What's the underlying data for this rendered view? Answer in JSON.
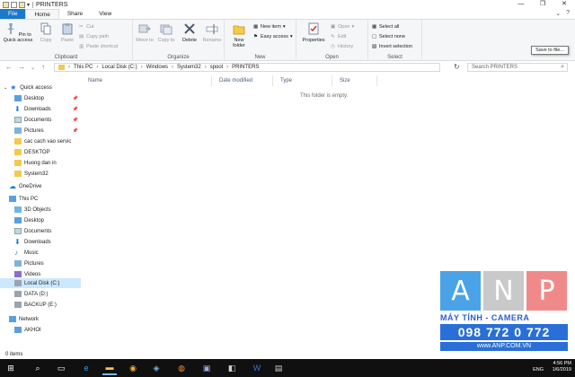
{
  "window": {
    "title": "PRINTERS"
  },
  "ribbon_tabs": [
    "File",
    "Home",
    "Share",
    "View"
  ],
  "ribbon": {
    "clipboard": {
      "label": "Clipboard",
      "pin": "Pin to Quick access",
      "copy": "Copy",
      "paste": "Paste",
      "cut": "Cut",
      "copy_path": "Copy path",
      "paste_shortcut": "Paste shortcut"
    },
    "organize": {
      "label": "Organize",
      "move_to": "Move to",
      "copy_to": "Copy to",
      "delete": "Delete",
      "rename": "Rename"
    },
    "new": {
      "label": "New",
      "new_folder": "New folder",
      "new_item": "New item",
      "easy_access": "Easy access"
    },
    "open": {
      "label": "Open",
      "properties": "Properties",
      "open": "Open",
      "edit": "Edit",
      "history": "History"
    },
    "select": {
      "label": "Select",
      "select_all": "Select all",
      "select_none": "Select none",
      "invert": "Invert selection"
    }
  },
  "tooltip": "Save to file...",
  "breadcrumb": [
    "This PC",
    "Local Disk (C:)",
    "Windows",
    "System32",
    "spool",
    "PRINTERS"
  ],
  "search": {
    "placeholder": "Search PRINTERS"
  },
  "nav": {
    "quick_access": "Quick access",
    "quick_items": [
      "Desktop",
      "Downloads",
      "Documents",
      "Pictures",
      "cac cach vao servic",
      "DESKTOP",
      "Huong dan in",
      "System32"
    ],
    "onedrive": "OneDrive",
    "this_pc": "This PC",
    "pc_items": [
      "3D Objects",
      "Desktop",
      "Documents",
      "Downloads",
      "Music",
      "Pictures",
      "Videos",
      "Local Disk (C:)",
      "DATA (D:)",
      "BACKUP (E:)"
    ],
    "network": "Network",
    "network_items": [
      "AKHOI"
    ]
  },
  "columns": [
    "Name",
    "Date modified",
    "Type",
    "Size"
  ],
  "empty_message": "This folder is empty.",
  "status": "0 items",
  "clock": {
    "time": "4:56 PM",
    "date": "1/6/2019"
  },
  "tray_lang": "ENG",
  "watermark": {
    "letters": [
      "A",
      "N",
      "P"
    ],
    "brand": "MÁY TÍNH - CAMERA",
    "phone": "098 772 0 772",
    "site": "www.ANP.COM.VN"
  },
  "colors": {
    "file_tab": "#1979ca",
    "selected": "#cce8ff",
    "anp_a": "#4aa3e6",
    "anp_n": "#c9c9c9",
    "anp_p": "#f08a8a"
  }
}
